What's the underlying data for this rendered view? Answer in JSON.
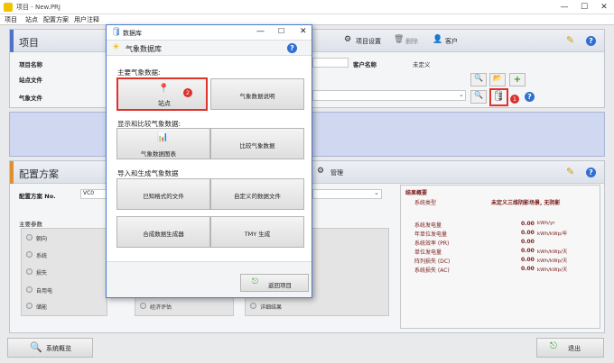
{
  "window": {
    "title": "项目 - New.PRJ",
    "min": "—",
    "max": "☐",
    "close": "✕"
  },
  "menu": [
    "项目",
    "站点",
    "配置方案",
    "用户注释"
  ],
  "project": {
    "title": "项目",
    "settings_btn": "项目设置",
    "delete_btn": "删除",
    "client_btn": "客户",
    "name_label": "项目名称",
    "site_file_label": "站点文件",
    "met_file_label": "气象文件",
    "client_name_label": "客户名称",
    "client_name_value": "未定义"
  },
  "config": {
    "title": "配置方案",
    "manage_btn": "管理",
    "variant_label": "配置方案 No.",
    "variant_value": "VC0",
    "main_params": "主要参数",
    "options_left": [
      "朝向",
      "系统",
      "损失",
      "自用电",
      "储能"
    ],
    "option_mid": "经济评估",
    "option_right": "详细结果"
  },
  "results": {
    "title": "结果概要",
    "type_label": "系统类型",
    "type_value": "未定义三维阴影场景, 无阴影",
    "rows": [
      {
        "label": "系统发电量",
        "value": "0.00",
        "unit": "kWh/yr"
      },
      {
        "label": "年单位发电量",
        "value": "0.00",
        "unit": "kWh/kWp/年"
      },
      {
        "label": "系统效率 (PR)",
        "value": "0.00",
        "unit": ""
      },
      {
        "label": "单位发电量",
        "value": "0.00",
        "unit": "kWh/kWp/天"
      },
      {
        "label": "阵列损失 (DC)",
        "value": "0.00",
        "unit": "kWh/kWp/天"
      },
      {
        "label": "系统损失 (AC)",
        "value": "0.00",
        "unit": "kWh/kWp/天"
      }
    ]
  },
  "footer": {
    "overview_btn": "系统概览",
    "exit_btn": "退出"
  },
  "dialog": {
    "title": "数据库",
    "header": "气象数据库",
    "sec1": "主要气象数据:",
    "btn_site": "站点",
    "btn_met_desc": "气象数据说明",
    "sec2": "显示和比较气象数据:",
    "btn_met_chart": "气象数据图表",
    "btn_compare": "比较气象数据",
    "sec3": "导入和生成气象数据",
    "btn_known": "已知格式的文件",
    "btn_custom": "自定义的数据文件",
    "btn_synth": "合成数据生成器",
    "btn_tmy": "TMY 生成",
    "back_btn": "返回项目",
    "badge": "2"
  },
  "badge_main": "1"
}
